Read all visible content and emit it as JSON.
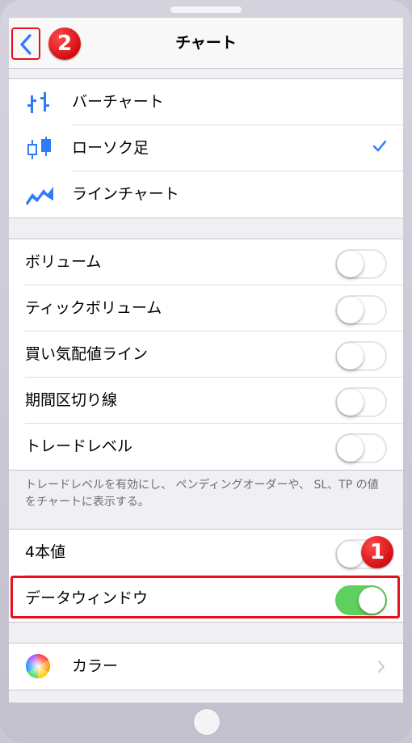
{
  "nav": {
    "title": "チャート"
  },
  "badges": {
    "back": "2",
    "toggle": "1"
  },
  "chart_types": [
    {
      "label": "バーチャート",
      "icon": "bar-chart-icon",
      "selected": false
    },
    {
      "label": "ローソク足",
      "icon": "candlestick-icon",
      "selected": true
    },
    {
      "label": "ラインチャート",
      "icon": "line-chart-icon",
      "selected": false
    }
  ],
  "display_options": [
    {
      "label": "ボリューム",
      "on": false
    },
    {
      "label": "ティックボリューム",
      "on": false
    },
    {
      "label": "買い気配値ライン",
      "on": false
    },
    {
      "label": "期間区切り線",
      "on": false
    },
    {
      "label": "トレードレベル",
      "on": false
    }
  ],
  "footnote": "トレードレベルを有効にし、 ペンディングオーダーや、 SL、TP の値をチャートに表示する。",
  "extra_options": [
    {
      "label": "4本値",
      "on": false
    },
    {
      "label": "データウィンドウ",
      "on": true
    }
  ],
  "color_row": {
    "label": "カラー",
    "icon": "color-wheel-icon"
  },
  "colors": {
    "accent": "#2f7cf6",
    "toggle_on": "#5fd05f",
    "highlight": "#e5121e"
  }
}
